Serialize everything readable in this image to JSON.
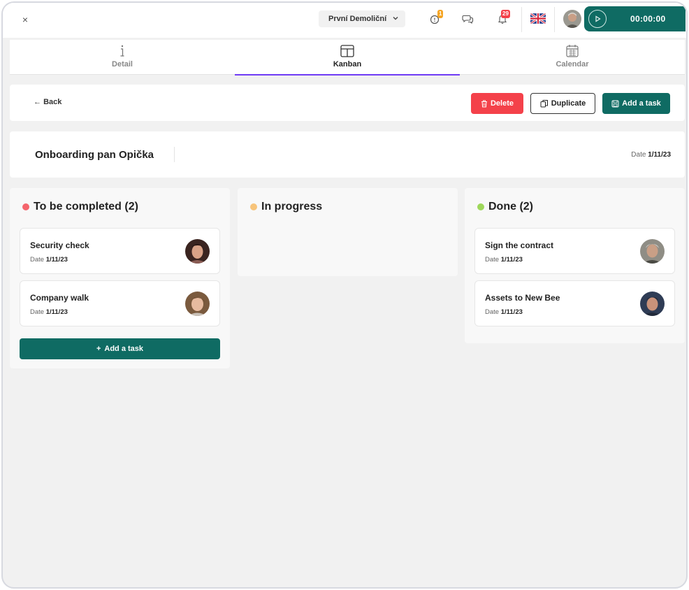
{
  "topbar": {
    "close_icon": "×",
    "company": "První Demoliční",
    "alerts_badge": "1",
    "notifications_badge": "29",
    "timer": "00:00:00",
    "colors": {
      "primary": "#0f6b63",
      "alert_badge": "#f5a524",
      "notif_badge": "#f4414a"
    }
  },
  "tabs": [
    {
      "label": "Detail",
      "icon": "info-icon"
    },
    {
      "label": "Kanban",
      "icon": "board-icon",
      "active": true
    },
    {
      "label": "Calendar",
      "icon": "calendar-icon"
    }
  ],
  "actions": {
    "back": "Back",
    "delete": "Delete",
    "duplicate": "Duplicate",
    "add_task": "Add a task"
  },
  "project": {
    "title": "Onboarding pan Opička",
    "date_label": "Date",
    "date": "1/11/23"
  },
  "columns": [
    {
      "title": "To be completed (2)",
      "color": "#f4646c",
      "cards": [
        {
          "title": "Security check",
          "date_label": "Date",
          "date": "1/11/23"
        },
        {
          "title": "Company walk",
          "date_label": "Date",
          "date": "1/11/23"
        }
      ],
      "add_label": "Add a task"
    },
    {
      "title": "In progress",
      "color": "#f7c47a",
      "cards": []
    },
    {
      "title": "Done (2)",
      "color": "#9ed85a",
      "cards": [
        {
          "title": "Sign the contract",
          "date_label": "Date",
          "date": "1/11/23"
        },
        {
          "title": "Assets to New Bee",
          "date_label": "Date",
          "date": "1/11/23"
        }
      ]
    }
  ]
}
